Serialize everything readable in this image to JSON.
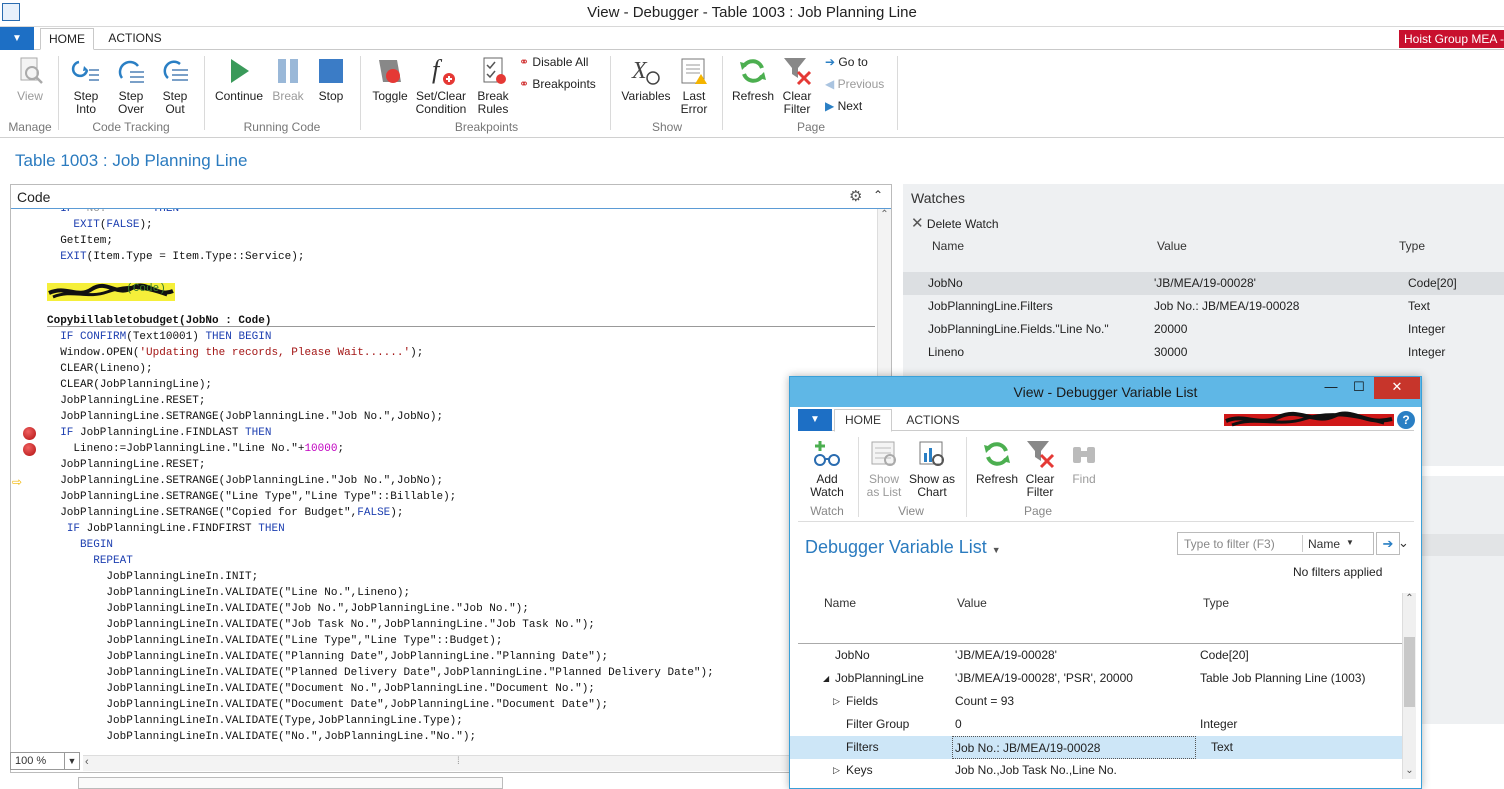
{
  "window": {
    "title": "View - Debugger - Table 1003 : Job Planning Line"
  },
  "menu": {
    "file_glyph": "▼",
    "tabs": [
      "HOME",
      "ACTIONS"
    ],
    "company": "Hoist Group MEA -"
  },
  "ribbon": {
    "view": "View",
    "step_into": [
      "Step",
      "Into"
    ],
    "step_over": [
      "Step",
      "Over"
    ],
    "step_out": [
      "Step",
      "Out"
    ],
    "continue": "Continue",
    "break": "Break",
    "stop": "Stop",
    "toggle": "Toggle",
    "set_clear": [
      "Set/Clear",
      "Condition"
    ],
    "break_rules": [
      "Break",
      "Rules"
    ],
    "disable_all": "Disable All",
    "breakpoints": "Breakpoints",
    "variables": "Variables",
    "last_error": [
      "Last",
      "Error"
    ],
    "refresh": "Refresh",
    "clear_filter": [
      "Clear",
      "Filter"
    ],
    "go_to": "Go to",
    "previous": "Previous",
    "next": "Next",
    "groups": [
      "Manage",
      "Code Tracking",
      "Running Code",
      "Breakpoints",
      "Show",
      "Page"
    ]
  },
  "page_title": "Table 1003 : Job Planning Line",
  "code_panel": {
    "title": "Code",
    "lines": [
      "  IF \"No.\" = '' THEN",
      "    EXIT(FALSE);",
      "  GetItem;",
      "  EXIT(Item.Type = Item.Type::Service);",
      "",
      "            (Code)",
      "",
      "Copybillabletobudget(JobNo : Code)",
      "  IF CONFIRM(Text10001) THEN BEGIN",
      "  Window.OPEN('Updating the records, Please Wait......');",
      "  CLEAR(Lineno);",
      "  CLEAR(JobPlanningLine);",
      "  JobPlanningLine.RESET;",
      "  JobPlanningLine.SETRANGE(JobPlanningLine.\"Job No.\",JobNo);",
      "  IF JobPlanningLine.FINDLAST THEN",
      "    Lineno:=JobPlanningLine.\"Line No.\"+10000;",
      "  JobPlanningLine.RESET;",
      "  JobPlanningLine.SETRANGE(JobPlanningLine.\"Job No.\",JobNo);",
      "  JobPlanningLine.SETRANGE(\"Line Type\",\"Line Type\"::Billable);",
      "  JobPlanningLine.SETRANGE(\"Copied for Budget\",FALSE);",
      "   IF JobPlanningLine.FINDFIRST THEN",
      "     BEGIN",
      "       REPEAT",
      "         JobPlanningLineIn.INIT;",
      "         JobPlanningLineIn.VALIDATE(\"Line No.\",Lineno);",
      "         JobPlanningLineIn.VALIDATE(\"Job No.\",JobPlanningLine.\"Job No.\");",
      "         JobPlanningLineIn.VALIDATE(\"Job Task No.\",JobPlanningLine.\"Job Task No.\");",
      "         JobPlanningLineIn.VALIDATE(\"Line Type\",\"Line Type\"::Budget);",
      "         JobPlanningLineIn.VALIDATE(\"Planning Date\",JobPlanningLine.\"Planning Date\");",
      "         JobPlanningLineIn.VALIDATE(\"Planned Delivery Date\",JobPlanningLine.\"Planned Delivery Date\");",
      "         JobPlanningLineIn.VALIDATE(\"Document No.\",JobPlanningLine.\"Document No.\");",
      "         JobPlanningLineIn.VALIDATE(\"Document Date\",JobPlanningLine.\"Document Date\");",
      "         JobPlanningLineIn.VALIDATE(Type,JobPlanningLine.Type);",
      "         JobPlanningLineIn.VALIDATE(\"No.\",JobPlanningLine.\"No.\");"
    ],
    "zoom": "100 %"
  },
  "watches": {
    "title": "Watches",
    "delete_watch": "Delete Watch",
    "columns": [
      "Name",
      "Value",
      "Type"
    ],
    "rows": [
      {
        "name": "JobNo",
        "value": "'JB/MEA/19-00028'",
        "type": "Code[20]"
      },
      {
        "name": "JobPlanningLine.Filters",
        "value": "Job No.: JB/MEA/19-00028",
        "type": "Text"
      },
      {
        "name": "JobPlanningLine.Fields.\"Line No.\"",
        "value": "20000",
        "type": "Integer"
      },
      {
        "name": "Lineno",
        "value": "30000",
        "type": "Integer"
      }
    ]
  },
  "dialog": {
    "title": "View - Debugger Variable List",
    "tabs": [
      "HOME",
      "ACTIONS"
    ],
    "ribbon": {
      "add_watch": [
        "Add",
        "Watch"
      ],
      "show_as_list": [
        "Show",
        "as List"
      ],
      "show_as_chart": [
        "Show as",
        "Chart"
      ],
      "refresh": "Refresh",
      "clear_filter": [
        "Clear",
        "Filter"
      ],
      "find": "Find",
      "groups": [
        "Watch",
        "View",
        "Page"
      ]
    },
    "list_title": "Debugger Variable List",
    "filter_placeholder": "Type to filter (F3)",
    "filter_field": "Name",
    "no_filters": "No filters applied",
    "columns": [
      "Name",
      "Value",
      "Type"
    ],
    "rows": [
      {
        "name": "JobNo",
        "value": "'JB/MEA/19-00028'",
        "type": "Code[20]",
        "expander": ""
      },
      {
        "name": "JobPlanningLine",
        "value": "'JB/MEA/19-00028', 'PSR', 20000",
        "type": "Table Job Planning Line (1003)",
        "expander": "◢"
      },
      {
        "name": "Fields",
        "value": "Count = 93",
        "type": "",
        "expander": "▷"
      },
      {
        "name": "Filter Group",
        "value": "0",
        "type": "Integer",
        "expander": ""
      },
      {
        "name": "Filters",
        "value": "Job No.: JB/MEA/19-00028",
        "type": "Text",
        "expander": ""
      },
      {
        "name": "Keys",
        "value": "Job No.,Job Task No.,Line No.",
        "type": "",
        "expander": "▷"
      }
    ]
  }
}
